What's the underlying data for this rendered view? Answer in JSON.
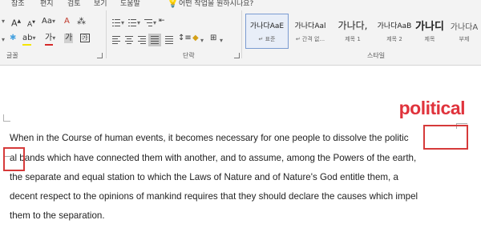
{
  "tabs": [
    "참조",
    "편지",
    "검토",
    "보기",
    "도움말"
  ],
  "tell_me": "어떤 작업을 원하시나요?",
  "groups": {
    "font": "글꼴",
    "paragraph": "단락",
    "styles": "스타일"
  },
  "font_controls": {
    "size_up": "A",
    "size_down": "A",
    "change_case": "Aa",
    "clear_format": "A",
    "highlight": "ab",
    "font_color": "가",
    "shade": "가"
  },
  "styles": [
    {
      "sample": "가나다AaE",
      "name": "↵ 표준"
    },
    {
      "sample": "가나다Aal",
      "name": "↵ 간격 없..."
    },
    {
      "sample": "가나다,",
      "name": "제목 1"
    },
    {
      "sample": "가나다AaB",
      "name": "제목 2"
    },
    {
      "sample": "가나디",
      "name": "제목"
    },
    {
      "sample": "가나다A",
      "name": "부제"
    }
  ],
  "callout": "political",
  "document": {
    "lines": [
      "When in the Course of human events, it becomes necessary for one people to dissolve the politic",
      "al bands which have connected them with another, and to assume, among the Powers of the earth,",
      "the separate and equal station to which the Laws of Nature and of Nature's God entitle them, a",
      "decent respect to the opinions of mankind requires that they should declare the causes which impel",
      "them to the separation."
    ]
  },
  "colors": {
    "accent_red": "#e0333c",
    "highlight_yellow": "#f5e500",
    "font_color_red": "#d62929",
    "selected_style_border": "#7a9bd1"
  }
}
